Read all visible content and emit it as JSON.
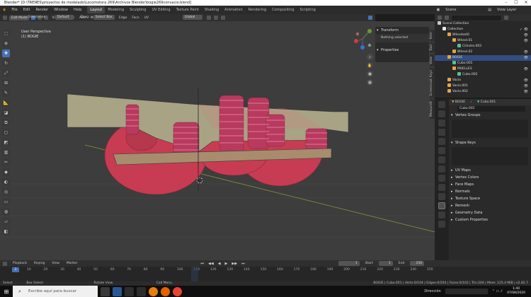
{
  "titlebar": {
    "title": "Blender* [D:\\TRENES\\proyectos de modelado\\Locomotora 269\\Archivos Blender\\bogie269convacio.blend]"
  },
  "menus": [
    "File",
    "Edit",
    "Render",
    "Window",
    "Help"
  ],
  "workspaces": [
    "Layout",
    "Modeling",
    "Sculpting",
    "UV Editing",
    "Texture Paint",
    "Shading",
    "Animation",
    "Rendering",
    "Compositing",
    "Scripting"
  ],
  "scene": {
    "scene_label": "Scene",
    "view_layer": "View Layer"
  },
  "viewport_header": {
    "mode": "Edit Mode",
    "view": "View",
    "select": "Select",
    "add": "Add",
    "mesh": "Mesh",
    "vertex": "Vertex",
    "edge": "Edge",
    "face": "Face",
    "uv": "UV",
    "orientation_label": "Orientation:",
    "orientation_value": "Default",
    "drag_label": "Drag:",
    "drag_value": "Select Box",
    "transform_space": "Global",
    "options": "Options"
  },
  "viewport_info": {
    "view_name": "User Perspective",
    "object": "(1) BOGIE"
  },
  "npanel": {
    "transform_title": "Transform",
    "nothing_selected": "Nothing selected",
    "properties_title": "Properties",
    "tabs": [
      "Item",
      "Tool",
      "View",
      "Screencast Keys",
      "MeasureIt"
    ]
  },
  "outliner": {
    "rows": [
      {
        "label": "Scene Collection",
        "indent": 0,
        "color": "#cccccc",
        "vis": "",
        "selected": false
      },
      {
        "label": "Collection",
        "indent": 1,
        "color": "#e8e8e8",
        "vis": "✓ 👁",
        "selected": false
      },
      {
        "label": "Wheelset0",
        "indent": 2,
        "color": "#e3a34a",
        "vis": "👁",
        "selected": false
      },
      {
        "label": "Wheel.01",
        "indent": 3,
        "color": "#e3a34a",
        "vis": "👁",
        "selected": false
      },
      {
        "label": "Cilindro.003",
        "indent": 4,
        "color": "#59c18c",
        "vis": "",
        "selected": false
      },
      {
        "label": "Wheel.02",
        "indent": 3,
        "color": "#e3a34a",
        "vis": "👁",
        "selected": false
      },
      {
        "label": "BOGIE",
        "indent": 2,
        "color": "#e3a34a",
        "vis": "👁",
        "selected": true
      },
      {
        "label": "Cubo.001",
        "indent": 3,
        "color": "#59c18c",
        "vis": "",
        "selected": false
      },
      {
        "label": "MUELLES",
        "indent": 3,
        "color": "#e3a34a",
        "vis": "👁",
        "selected": false
      },
      {
        "label": "Cubo.002",
        "indent": 4,
        "color": "#59c18c",
        "vis": "",
        "selected": false
      },
      {
        "label": "Vacio",
        "indent": 2,
        "color": "#e3a34a",
        "vis": "👁",
        "selected": false
      },
      {
        "label": "Vacio.001",
        "indent": 2,
        "color": "#e3a34a",
        "vis": "👁",
        "selected": false
      },
      {
        "label": "Vacio.002",
        "indent": 2,
        "color": "#e3a34a",
        "vis": "👁",
        "selected": false
      }
    ]
  },
  "properties": {
    "breadcrumb_object": "BOGIE",
    "breadcrumb_mesh": "Cubo.001",
    "mesh_name": "Cubo.001",
    "sections": [
      {
        "label": "Vertex Groups",
        "open": true
      },
      {
        "label": "Shape Keys",
        "open": true
      },
      {
        "label": "UV Maps",
        "open": false
      },
      {
        "label": "Vertex Colors",
        "open": false
      },
      {
        "label": "Face Maps",
        "open": false
      },
      {
        "label": "Normals",
        "open": false
      },
      {
        "label": "Texture Space",
        "open": false
      },
      {
        "label": "Remesh",
        "open": false
      },
      {
        "label": "Geometry Data",
        "open": false
      },
      {
        "label": "Custom Properties",
        "open": false
      }
    ]
  },
  "timeline_header": {
    "playback": "Playback",
    "keying": "Keying",
    "view": "View",
    "marker": "Marker",
    "current_frame": "1",
    "start_label": "Start",
    "start": "1",
    "end_label": "End",
    "end": "250"
  },
  "timeline": {
    "current_frame": "1",
    "ticks": [
      "10",
      "20",
      "30",
      "40",
      "50",
      "60",
      "70",
      "80",
      "90",
      "100",
      "110",
      "120",
      "130",
      "140",
      "150",
      "160",
      "170",
      "180",
      "190",
      "200",
      "210",
      "220",
      "230",
      "240",
      "250"
    ]
  },
  "statusbar": {
    "select": "Select",
    "box_select": "Box Select",
    "rotate_view": "Rotate View",
    "call_menu": "Call Menu",
    "stats": "BOGIE | Cubo.001 | Verts:0/104 | Edges:0/204 | Faces:0/102 | Tris:204 | Mem: 125.4 MiB | v2.82.7"
  },
  "taskbar": {
    "search_placeholder": "Escribe aquí para buscar",
    "tray_label": "Dirección",
    "time": "1:40",
    "date": "07/08/2020"
  },
  "colors": {
    "accent": "#4772b3",
    "frame_tan": "#a8a385",
    "spring": "#b83a5e",
    "wheel": "#c73c52"
  }
}
